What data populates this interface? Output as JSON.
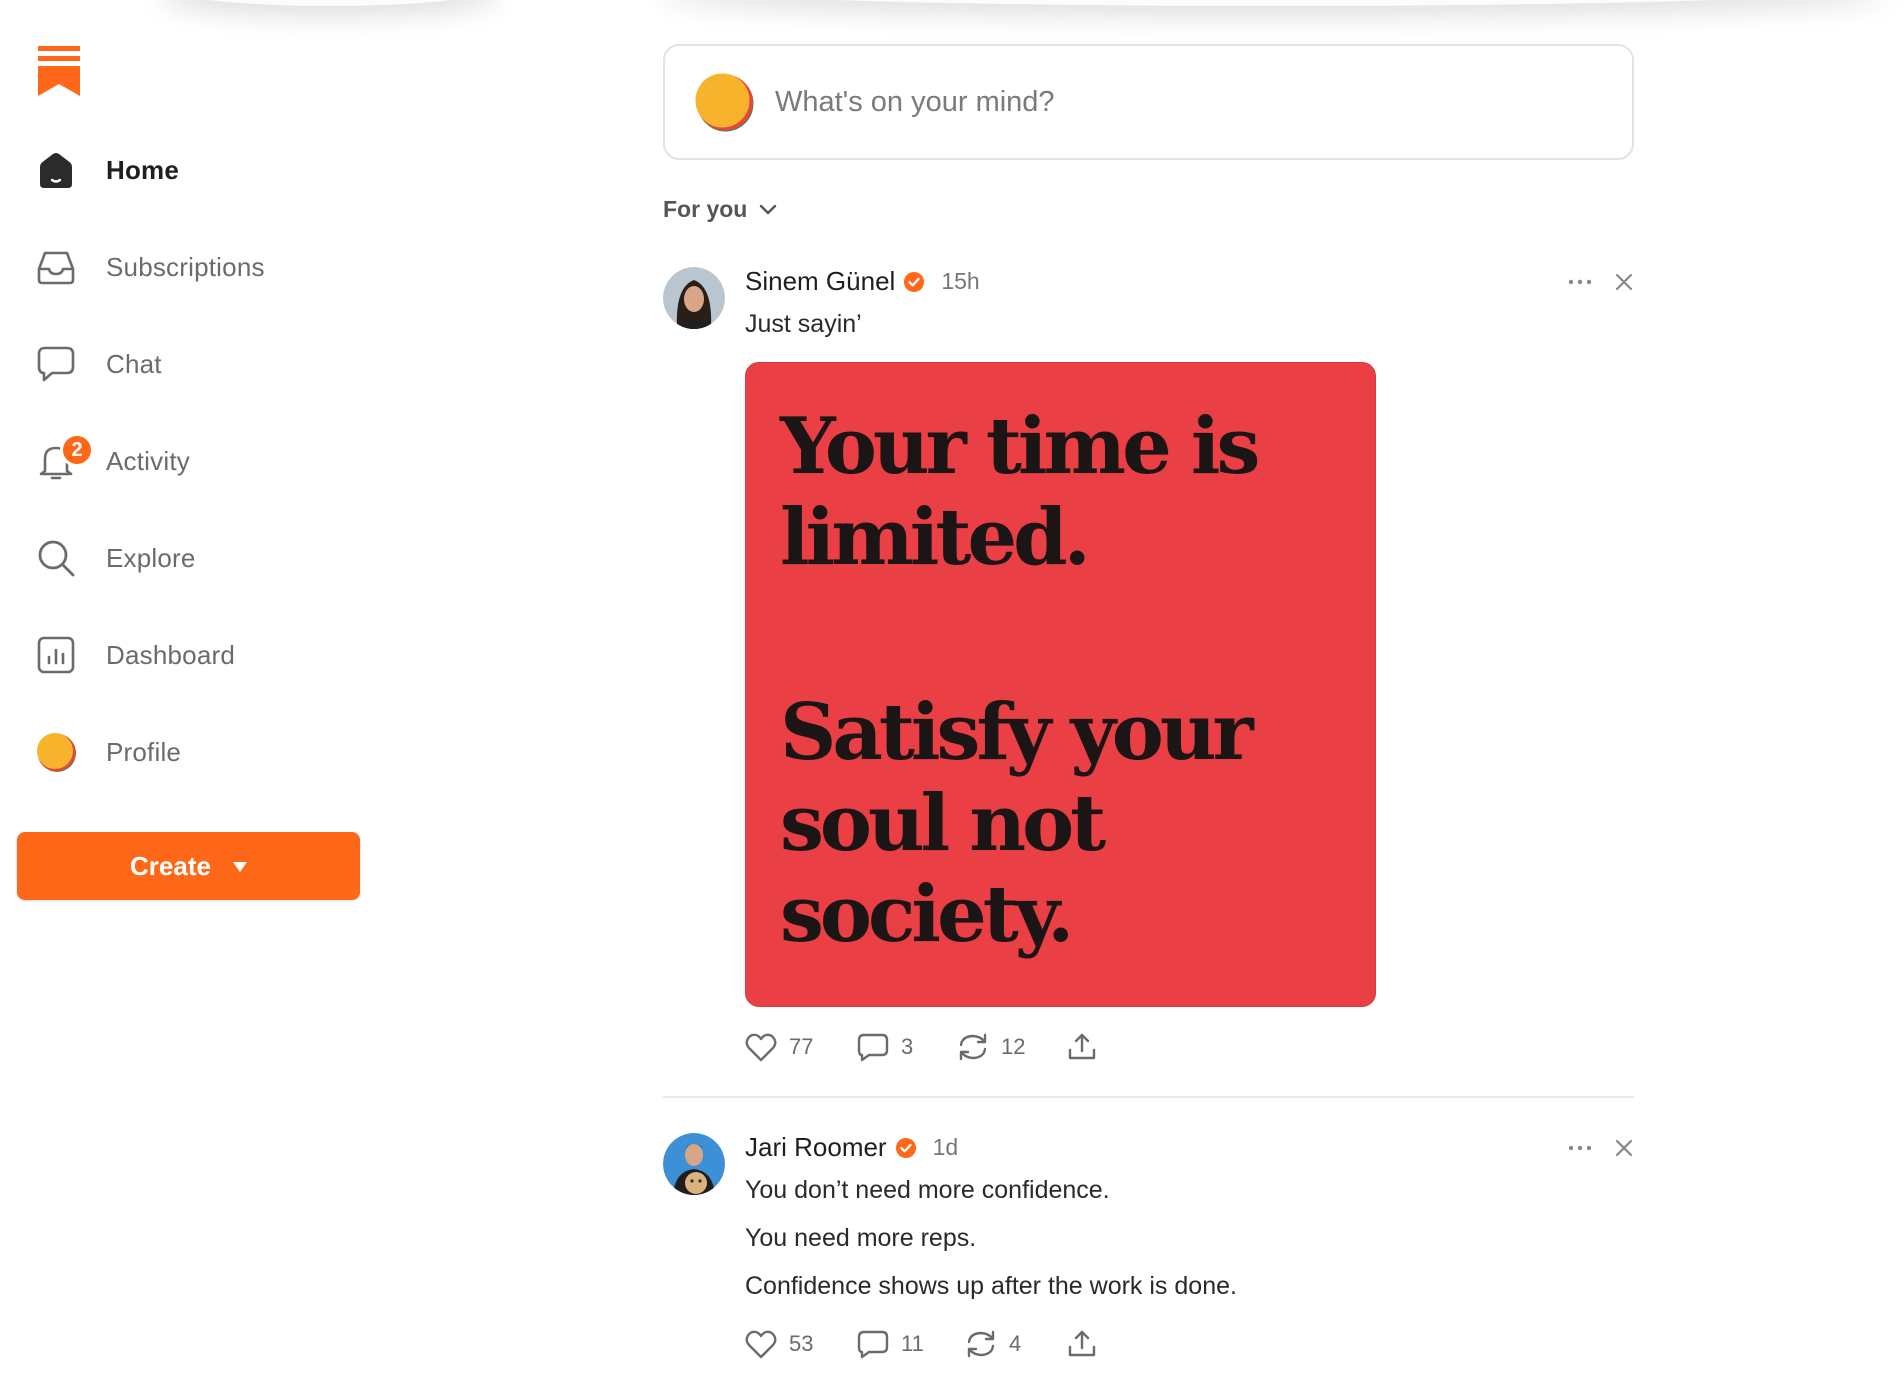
{
  "sidebar": {
    "logo_icon": "bookmark-logo-icon",
    "items": [
      {
        "label": "Home",
        "icon": "home-icon",
        "active": true
      },
      {
        "label": "Subscriptions",
        "icon": "inbox-icon"
      },
      {
        "label": "Chat",
        "icon": "chat-bubble-icon"
      },
      {
        "label": "Activity",
        "icon": "bell-icon",
        "badge": "2"
      },
      {
        "label": "Explore",
        "icon": "search-icon"
      },
      {
        "label": "Dashboard",
        "icon": "bar-chart-icon"
      },
      {
        "label": "Profile",
        "icon": "avatar-icon"
      }
    ],
    "create_label": "Create"
  },
  "composer": {
    "placeholder": "What's on your mind?"
  },
  "feed": {
    "filter_label": "For you",
    "posts": [
      {
        "author": "Sinem Günel",
        "time": "15h",
        "text": [
          "Just sayin’"
        ],
        "image_text": [
          "Your time is",
          "limited.",
          "Satisfy your",
          "soul not",
          "society."
        ],
        "likes": "77",
        "comments": "3",
        "restacks": "12"
      },
      {
        "author": "Jari Roomer",
        "time": "1d",
        "text": [
          "You don’t need more confidence.",
          "You need more reps.",
          "Confidence shows up after the work is done."
        ],
        "likes": "53",
        "comments": "11",
        "restacks": "4"
      }
    ]
  },
  "colors": {
    "accent": "#ff6719",
    "image_bg": "#ea3f44",
    "text": "#363737"
  }
}
